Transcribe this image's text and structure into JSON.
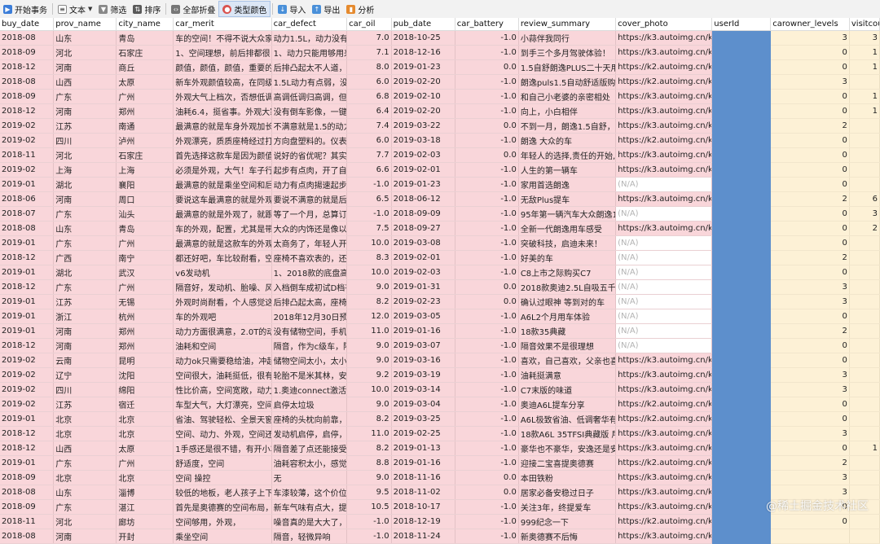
{
  "toolbar": {
    "begin_tx": "开始事务",
    "text": "文本",
    "filter": "筛选",
    "sort": "排序",
    "collapse_all": "全部折叠",
    "type_color": "类型颜色",
    "import": "导入",
    "export": "导出",
    "analyze": "分析"
  },
  "columns": [
    "buy_date",
    "prov_name",
    "city_name",
    "car_merit",
    "car_defect",
    "car_oil",
    "pub_date",
    "car_battery",
    "review_summary",
    "cover_photo",
    "userId",
    "carowner_levels",
    "visitcou"
  ],
  "rows": [
    [
      "2018-08",
      "山东",
      "青岛",
      "车的空间！不得不说大众家",
      "动力1.5L，动力没有那么大",
      "7.0",
      "2018-10-25",
      "-1.0",
      "小蒜伴我同行",
      "https://k3.autoimg.cn/ko",
      "",
      "3",
      "3"
    ],
    [
      "2018-09",
      "河北",
      "石家庄",
      "1、空间理想，前后排都很",
      "1、动力只能用够用来形容",
      "7.1",
      "2018-12-16",
      "-1.0",
      "到手三个多月驾驶体验！",
      "https://k3.autoimg.cn/ko",
      "",
      "0",
      "1"
    ],
    [
      "2018-12",
      "河南",
      "商丘",
      "颜值，颜值，颜值，重要的",
      "后排凸起太不人道，如果是",
      "8.0",
      "2019-01-23",
      "0.0",
      "1.5自舒朗逸PLUS二十天用车",
      "https://k2.autoimg.cn/ko",
      "",
      "0",
      "1"
    ],
    [
      "2018-08",
      "山西",
      "太原",
      "新车外观颜值较高，在同级",
      "1.5L动力有点弱，没有配备",
      "6.0",
      "2019-02-20",
      "-1.0",
      "朗逸puls1.5自动舒适版购车",
      "https://k2.autoimg.cn/ko",
      "",
      "3",
      ""
    ],
    [
      "2018-09",
      "广东",
      "广州",
      "外观大气上档次，否想低调",
      "高调低调归高调，但是实说",
      "6.8",
      "2019-02-10",
      "-1.0",
      "和自己小老婆的亲密相处",
      "https://k3.autoimg.cn/ko",
      "",
      "0",
      "1"
    ],
    [
      "2018-12",
      "河南",
      "郑州",
      "油耗6.4，挺省事。外观大家",
      "没有倒车影像，一键启动，",
      "6.4",
      "2019-02-20",
      "-1.0",
      "向上，小白相伴",
      "https://k3.autoimg.cn/ko",
      "",
      "0",
      "1"
    ],
    [
      "2019-02",
      "江苏",
      "南通",
      "最满意的就是车身外观加长了，",
      "不满意就是1.5的动力有实",
      "7.4",
      "2019-03-22",
      "0.0",
      "不到一月，朗逸1.5自舒，用",
      "https://k3.autoimg.cn/ko",
      "",
      "2",
      ""
    ],
    [
      "2019-02",
      "四川",
      "泸州",
      "外观漂亮，质质座椅经过打",
      "方向盘塑料的。仪表盘在不",
      "6.0",
      "2019-03-18",
      "-1.0",
      "朗逸 大众的车",
      "https://k2.autoimg.cn/ko",
      "",
      "0",
      ""
    ],
    [
      "2018-11",
      "河北",
      "石家庄",
      "首先选择这款车是因为颜值",
      "说好的省优呢？其实我感觉",
      "7.7",
      "2019-02-03",
      "0.0",
      "年轻人的选择,责任的开始,",
      "https://k3.autoimg.cn/ko",
      "",
      "0",
      ""
    ],
    [
      "2019-02",
      "上海",
      "上海",
      "必须是外观，大气！车子行",
      "起步有点肉，开了自动驻车",
      "6.6",
      "2019-02-01",
      "-1.0",
      "人生的第一辆车",
      "https://k3.autoimg.cn/ko",
      "",
      "0",
      ""
    ],
    [
      "2019-01",
      "湖北",
      "襄阳",
      "最满意的就是乘坐空间和后",
      "动力有点肉揚速起步有点肉，",
      "-1.0",
      "2019-01-23",
      "-1.0",
      "家用首选朗逸",
      "(N/A)",
      "",
      "0",
      ""
    ],
    [
      "2018-06",
      "河南",
      "周口",
      "要说这车最满意的就是外观",
      "要说不满意的就是后悬挂我",
      "6.5",
      "2018-06-12",
      "-1.0",
      "无敌Plus提车",
      "https://k3.autoimg.cn/ko",
      "",
      "2",
      "6"
    ],
    [
      "2018-07",
      "广东",
      "汕头",
      "最满意的就是外观了，就跟",
      "等了一个月，总算订到黑色",
      "-1.0",
      "2018-09-09",
      "-1.0",
      "95年第一辆汽车大众朗逸18",
      "(N/A)",
      "",
      "0",
      "3"
    ],
    [
      "2018-08",
      "山东",
      "青岛",
      "车的外观，配置，尤其是带",
      "大众的内饰还是像以前一样,",
      "7.5",
      "2018-09-27",
      "-1.0",
      "全新一代朗逸用车感受",
      "https://k3.autoimg.cn/ko",
      "",
      "0",
      "2"
    ],
    [
      "2019-01",
      "广东",
      "广州",
      "最满意的就是这款车的外观",
      "太商务了，年轻人开出去会",
      "10.0",
      "2019-03-08",
      "-1.0",
      "突破科技，启迪未来！",
      "(N/A)",
      "",
      "0",
      ""
    ],
    [
      "2018-12",
      "广西",
      "南宁",
      "都还好吧，车比较耐看，空",
      "座椅不喜欢表的，还有就是低",
      "8.3",
      "2019-02-01",
      "-1.0",
      "好美的车",
      "(N/A)",
      "",
      "2",
      ""
    ],
    [
      "2019-01",
      "湖北",
      "武汉",
      "v6发动机",
      "1、2018款的底盘高度较20",
      "10.0",
      "2019-02-03",
      "-1.0",
      "C8上市之际购买C7",
      "(N/A)",
      "",
      "0",
      ""
    ],
    [
      "2018-12",
      "广东",
      "广州",
      "隔音好，发动机、胎噪、风",
      "入档倒车成初试D档有明显顿",
      "9.0",
      "2019-01-31",
      "0.0",
      "2018款奥迪2.5L自吸五千公",
      "(N/A)",
      "",
      "3",
      ""
    ],
    [
      "2019-01",
      "江苏",
      "无锡",
      "外观时尚耐看，个人感觉这",
      "后排凸起太高，座椅皮质太",
      "8.2",
      "2019-02-23",
      "0.0",
      "确认过眼神 等到对的车",
      "(N/A)",
      "",
      "3",
      ""
    ],
    [
      "2019-01",
      "浙江",
      "杭州",
      "车的外观吧",
      "2018年12月30日预订车辆准",
      "12.0",
      "2019-03-05",
      "-1.0",
      "A6L2个月用车体验",
      "(N/A)",
      "",
      "0",
      ""
    ],
    [
      "2019-01",
      "河南",
      "郑州",
      "动力方面很满意，2.0T的动",
      "没有储物空间，手机都没地",
      "11.0",
      "2019-01-16",
      "-1.0",
      "18款35典藏",
      "(N/A)",
      "",
      "2",
      ""
    ],
    [
      "2018-12",
      "河南",
      "郑州",
      "油耗和空间",
      "隔音，作为c级车，隔音有点",
      "9.0",
      "2019-03-07",
      "-1.0",
      "隔音效果不是很理想",
      "(N/A)",
      "",
      "0",
      ""
    ],
    [
      "2019-02",
      "云南",
      "昆明",
      "动力ok只需要稳给油，冲起",
      "储物空间太小，太小，连放",
      "9.0",
      "2019-03-16",
      "-1.0",
      "喜欢，自己喜欢，父亲也喜欢",
      "https://k3.autoimg.cn/ko",
      "",
      "0",
      ""
    ],
    [
      "2019-02",
      "辽宁",
      "沈阳",
      "空间很大，油耗挺低，很有",
      "轮胎不是米其林，安卓手机",
      "9.2",
      "2019-03-19",
      "-1.0",
      "油耗挺满意",
      "https://k3.autoimg.cn/ko",
      "",
      "3",
      ""
    ],
    [
      "2019-02",
      "四川",
      "绵阳",
      "性比价高，空间宽敞，动力",
      "1.奥迪connect激活麻烦且流",
      "10.0",
      "2019-03-14",
      "-1.0",
      "C7末版的味道",
      "https://k3.autoimg.cn/ko",
      "",
      "3",
      ""
    ],
    [
      "2019-02",
      "江苏",
      "宿迁",
      "车型大气，大灯漂亮，空间",
      "启停太垃圾",
      "9.0",
      "2019-03-04",
      "-1.0",
      "奥迪A6L提车分享",
      "https://k2.autoimg.cn/ko",
      "",
      "0",
      ""
    ],
    [
      "2019-01",
      "北京",
      "北京",
      "省油、驾驶轻松、全景天窗",
      "座椅的头枕向前靠，太硬了",
      "8.2",
      "2019-03-25",
      "-1.0",
      "A6L极致省油、低调奢华有品",
      "https://k2.autoimg.cn/ko",
      "",
      "0",
      ""
    ],
    [
      "2018-12",
      "北京",
      "北京",
      "空间、动力、外观，空间还",
      "发动机启停，启停，启停，",
      "11.0",
      "2019-02-25",
      "-1.0",
      "18款A6L 35TFSI典藏版 用车",
      "https://k3.autoimg.cn/ko",
      "",
      "3",
      ""
    ],
    [
      "2018-12",
      "山西",
      "太原",
      "1手感还是很不错，有开小车",
      "隔音差了点还能接受，最近",
      "8.2",
      "2019-01-13",
      "-1.0",
      "豪华也不豪华，安逸还是安逸",
      "https://k3.autoimg.cn/ko",
      "",
      "0",
      "1"
    ],
    [
      "2019-01",
      "广东",
      "广州",
      "舒适度，空间",
      "油耗容积太小，感觉总是要",
      "8.8",
      "2019-01-16",
      "-1.0",
      "迎接二宝喜提奥德赛",
      "https://k2.autoimg.cn/ko",
      "",
      "2",
      ""
    ],
    [
      "2018-09",
      "北京",
      "北京",
      "空间 操控",
      "无",
      "9.0",
      "2018-11-16",
      "0.0",
      "本田铁粉",
      "https://k3.autoimg.cn/ko",
      "",
      "3",
      ""
    ],
    [
      "2018-08",
      "山东",
      "淄博",
      "较低的地板，老人孩子上下",
      "车漆较薄，这个价位隔音差",
      "9.5",
      "2018-11-02",
      "0.0",
      "居家必备安稳过日子",
      "https://k3.autoimg.cn/ko",
      "",
      "3",
      ""
    ],
    [
      "2018-09",
      "广东",
      "湛江",
      "首先是奥德赛的空间布局，",
      "新车气味有点大，提车到现",
      "10.5",
      "2018-10-17",
      "-1.0",
      "关注3年，终提爱车",
      "https://k3.autoimg.cn/ko",
      "",
      "0",
      ""
    ],
    [
      "2018-11",
      "河北",
      "廊坊",
      "空间够用，外观，",
      "噪音真的是大大了，储物空",
      "-1.0",
      "2018-12-19",
      "-1.0",
      "999纪念一下",
      "https://k2.autoimg.cn/ko",
      "",
      "0",
      ""
    ],
    [
      "2018-08",
      "河南",
      "开封",
      "乘坐空间",
      "隔音，轻微异响",
      "-1.0",
      "2018-11-24",
      "-1.0",
      "新奥德赛不后悔",
      "https://k3.autoimg.cn/ko",
      "",
      "",
      ""
    ]
  ],
  "watermark": "@稀土掘金技术社区"
}
